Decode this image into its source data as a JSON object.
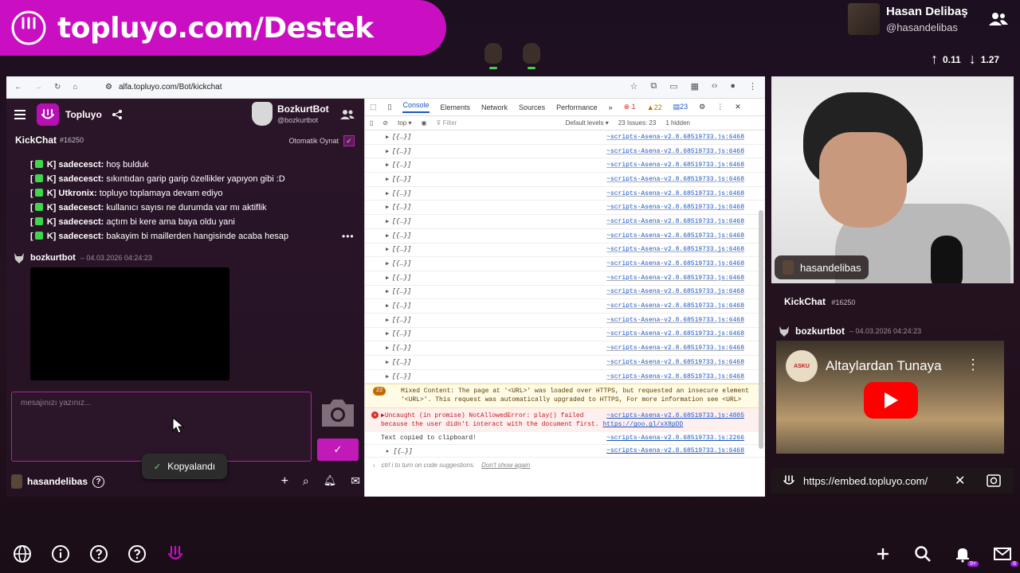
{
  "banner": {
    "text": "topluyo.com/Destek"
  },
  "profile": {
    "name": "Hasan Delibaş",
    "handle": "@hasandelibas",
    "up": "0.11",
    "down": "1.27"
  },
  "browser": {
    "url": "alfa.topluyo.com/Bot/kickchat"
  },
  "app": {
    "name": "Topluyo",
    "bot_name": "BozkurtBot",
    "bot_handle": "@bozkurtbot",
    "chat_title": "KickChat",
    "chat_id": "#16250",
    "autoplay_label": "Otomatik Oynat",
    "messages": [
      {
        "prefix": "[",
        "tag": "K]",
        "user": "sadecesct:",
        "text": "hoş bulduk"
      },
      {
        "prefix": "[",
        "tag": "K]",
        "user": "sadecesct:",
        "text": "sıkıntıdan garip garip özellikler yapıyon gibi :D"
      },
      {
        "prefix": "[",
        "tag": "K]",
        "user": "Utkronix:",
        "text": "topluyo toplamaya devam ediyo"
      },
      {
        "prefix": "[",
        "tag": "K]",
        "user": "sadecesct:",
        "text": "kullanıcı sayısı ne durumda var mı aktiflik"
      },
      {
        "prefix": "[",
        "tag": "K]",
        "user": "sadecesct:",
        "text": "açtım bi kere ama baya oldu yani"
      },
      {
        "prefix": "[",
        "tag": "K]",
        "user": "sadecesct:",
        "text": "bakayim bi maillerden hangisinde acaba hesap"
      }
    ],
    "bot_message_user": "bozkurtbot",
    "bot_message_time": "– 04.03.2026 04:24:23",
    "input_placeholder": "mesajınızı yazınız...",
    "send_label": "✓",
    "username": "hasandelibas",
    "toast": "Kopyalandı"
  },
  "devtools": {
    "tabs": [
      "Console",
      "Elements",
      "Network",
      "Sources",
      "Performance",
      "»"
    ],
    "err_count": "1",
    "warn_count": "22",
    "info_count": "23",
    "context": "top ▾",
    "filter_placeholder": "Filter",
    "levels": "Default levels ▾",
    "issues": "23 Issues: 23",
    "hidden": "1 hidden",
    "log_text": "[{…}]",
    "log_src": "~scripts-Asena-v2.8.68519733.js:6468",
    "top_partial": "[{…}]",
    "warn_count_badge": "22",
    "warn_text": "Mixed Content: The page at '<URL>' was loaded over HTTPS, but requested an insecure element '<URL>'. This request was automatically upgraded to HTTPS, For more information see <URL>",
    "err_text1": "▶Uncaught (in promise) NotAllowedError: play() failed",
    "err_text2": "because the user didn't interact with the document first.",
    "err_link": "https://goo.gl/xX8pDD",
    "err_src": "~scripts-Asena-v2.8.68519733.js:4805",
    "copied_text": "Text copied to clipboard!",
    "copied_src": "~scripts-Asena-v2.8.68519733.js:2266",
    "last_log": "[{…}]",
    "last_src": "~scripts-Asena-v2.8.68519733.js:6468",
    "prompt_text": "ctrl i to turn on code suggestions.",
    "prompt_link": "Don't show again"
  },
  "right_panel": {
    "cam_tag": "hasandelibas",
    "chat_title": "KickChat",
    "chat_id": "#16250",
    "bot_user": "bozkurtbot",
    "bot_time": "– 04.03.2026 04:24:23",
    "video_title": "Altaylardan Tunaya",
    "channel_badge": "ASKU",
    "embed_url": "https://embed.topluyo.com/"
  },
  "footer": {
    "bell_badge": "9+",
    "mail_badge": "6"
  },
  "colors": {
    "brand": "#c90fc1",
    "accent_green": "#3fd64b",
    "link_blue": "#1a56c4"
  }
}
